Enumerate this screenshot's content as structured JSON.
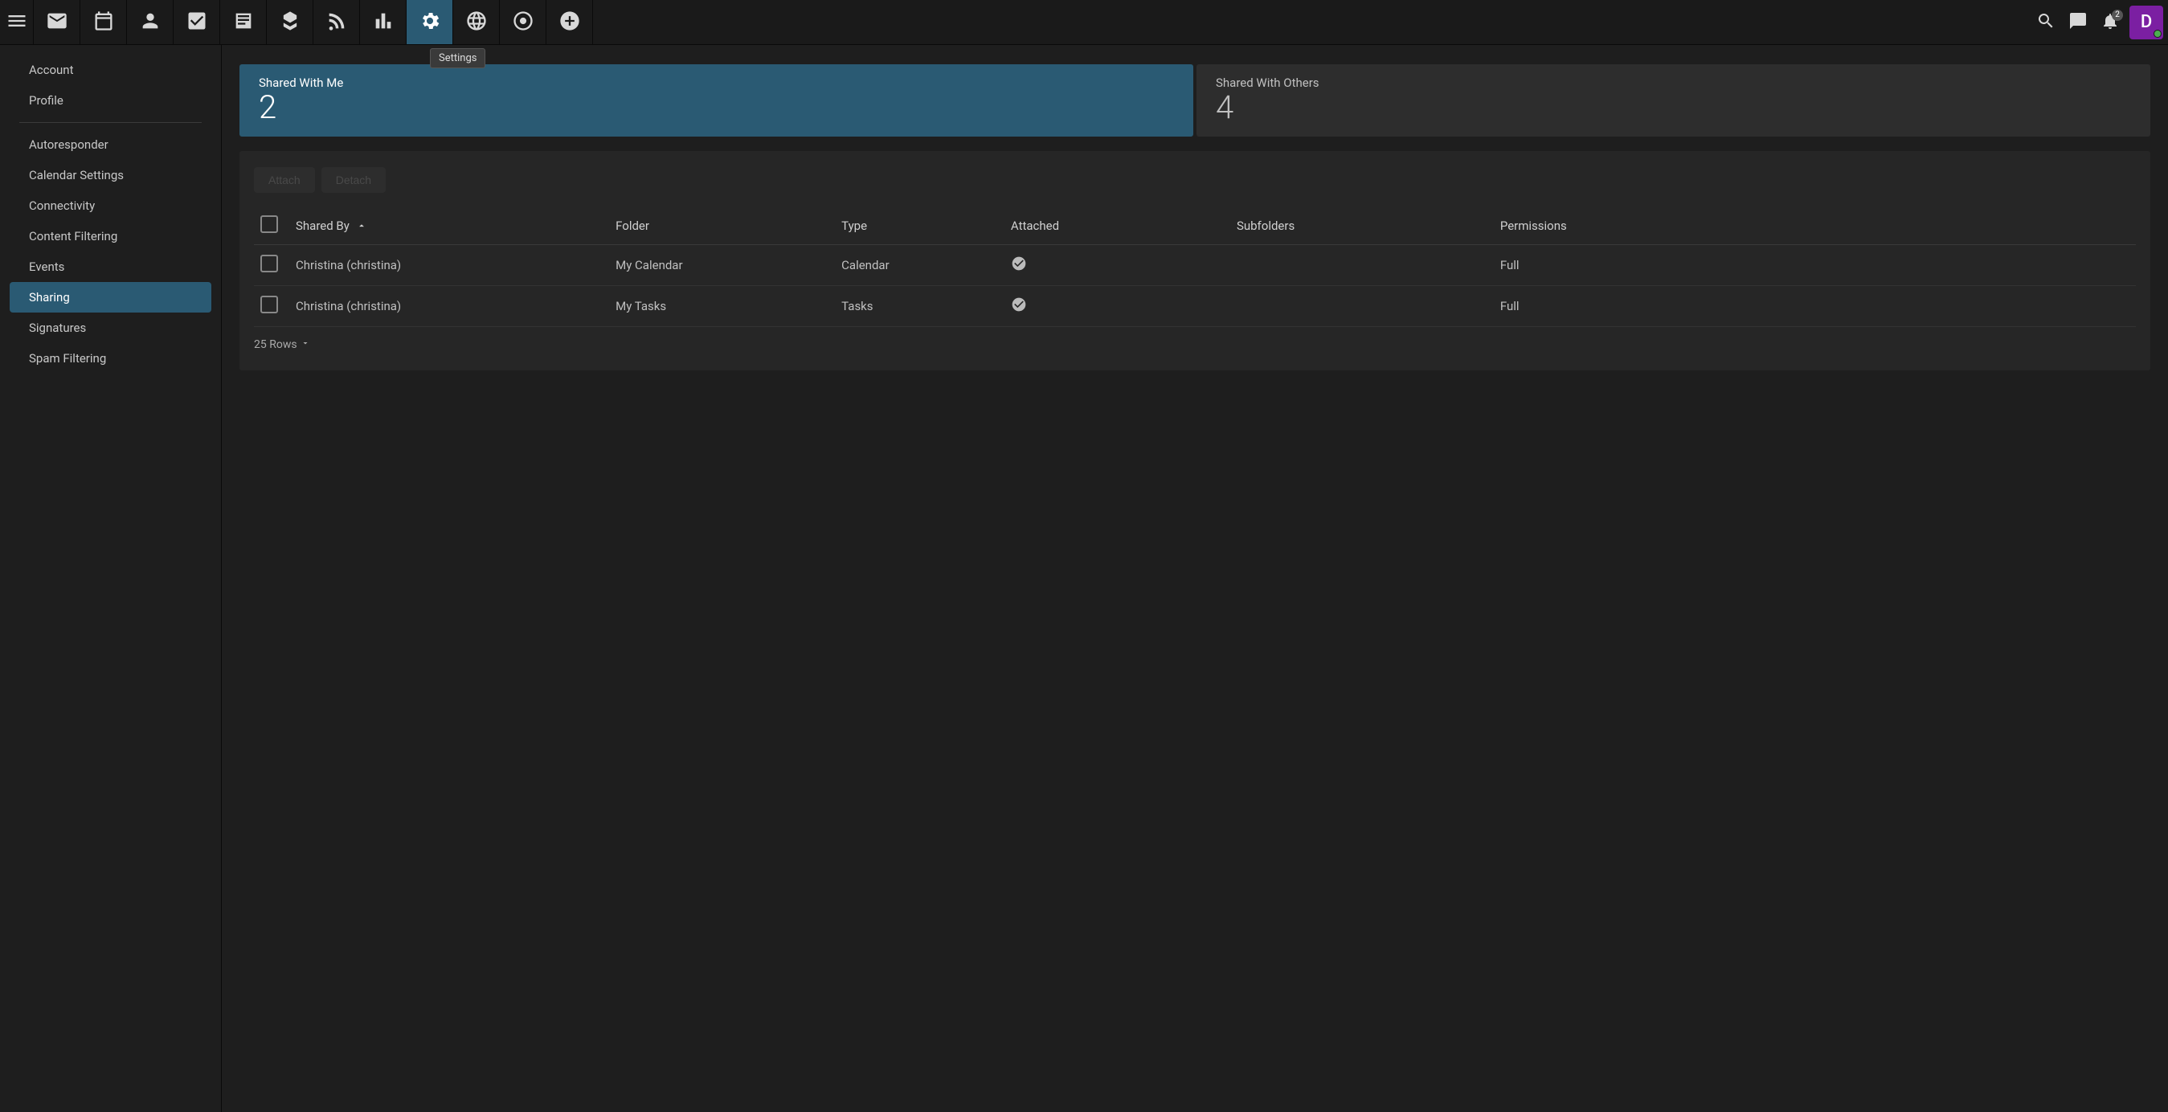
{
  "tooltip": "Settings",
  "topbar": {
    "notification_badge": "2",
    "avatar_initial": "D"
  },
  "sidebar": [
    {
      "label": "Account",
      "active": false,
      "divider_after": false
    },
    {
      "label": "Profile",
      "active": false,
      "divider_after": true
    },
    {
      "label": "Autoresponder",
      "active": false,
      "divider_after": false
    },
    {
      "label": "Calendar Settings",
      "active": false,
      "divider_after": false
    },
    {
      "label": "Connectivity",
      "active": false,
      "divider_after": false
    },
    {
      "label": "Content Filtering",
      "active": false,
      "divider_after": false
    },
    {
      "label": "Events",
      "active": false,
      "divider_after": false
    },
    {
      "label": "Sharing",
      "active": true,
      "divider_after": false
    },
    {
      "label": "Signatures",
      "active": false,
      "divider_after": false
    },
    {
      "label": "Spam Filtering",
      "active": false,
      "divider_after": false
    }
  ],
  "tabs": {
    "with_me": {
      "label": "Shared With Me",
      "count": "2",
      "active": true
    },
    "with_others": {
      "label": "Shared With Others",
      "count": "4",
      "active": false
    }
  },
  "buttons": {
    "attach": "Attach",
    "detach": "Detach"
  },
  "columns": {
    "shared_by": "Shared By",
    "folder": "Folder",
    "type": "Type",
    "attached": "Attached",
    "subfolders": "Subfolders",
    "permissions": "Permissions"
  },
  "rows": [
    {
      "shared_by": "Christina (christina)",
      "folder": "My Calendar",
      "type": "Calendar",
      "attached": true,
      "subfolders": "",
      "permissions": "Full"
    },
    {
      "shared_by": "Christina (christina)",
      "folder": "My Tasks",
      "type": "Tasks",
      "attached": true,
      "subfolders": "",
      "permissions": "Full"
    }
  ],
  "rows_selector": "25 Rows"
}
